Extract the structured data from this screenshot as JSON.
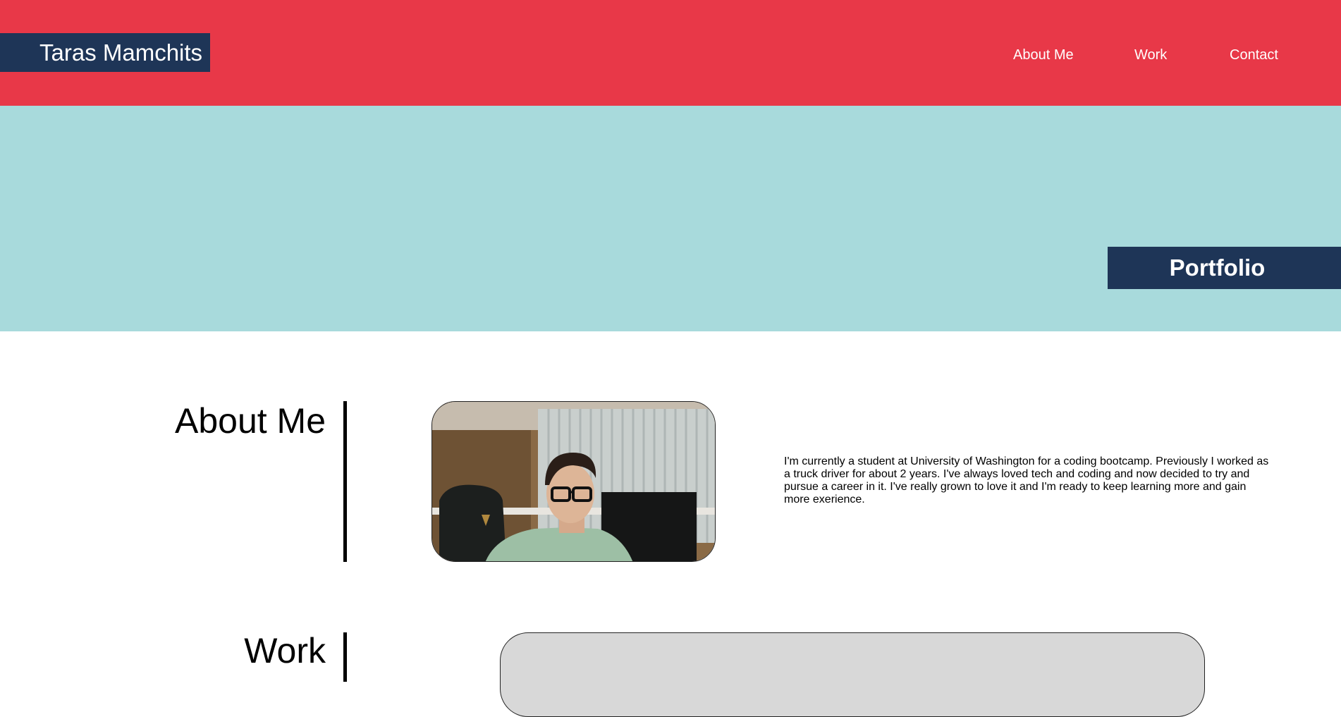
{
  "header": {
    "brand": "Taras Mamchits",
    "nav": [
      {
        "label": "About Me"
      },
      {
        "label": "Work"
      },
      {
        "label": "Contact"
      }
    ]
  },
  "hero": {
    "tag": "Portfolio"
  },
  "about": {
    "heading": "About Me",
    "text": "I'm currently a student at University of Washington for a coding bootcamp. Previously I worked as a truck driver for about 2 years. I've always loved tech and coding and now decided to try and pursue a career in it. I've really grown to love it and I'm ready to keep learning more and gain more exerience."
  },
  "work": {
    "heading": "Work"
  },
  "colors": {
    "header": "#e83848",
    "navy": "#1e3557",
    "hero": "#a8dadc",
    "card": "#d8d8d8"
  }
}
